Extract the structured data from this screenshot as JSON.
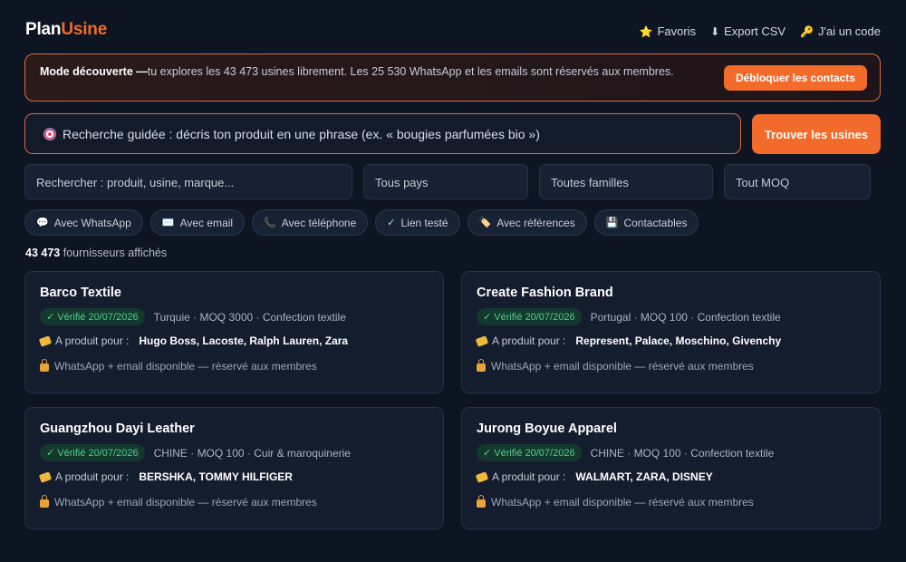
{
  "header": {
    "logo_part1": "Plan",
    "logo_part2": "Usine",
    "links": [
      {
        "icon": "star-icon",
        "glyph": "⭐",
        "label": "Favoris"
      },
      {
        "icon": "download-icon",
        "glyph": "⬇",
        "label": "Export CSV"
      },
      {
        "icon": "key-icon",
        "glyph": "🔑",
        "label": "J'ai un code"
      }
    ]
  },
  "banner": {
    "title": "Mode découverte —",
    "text": "tu explores les 43 473 usines librement. Les 25 530 WhatsApp et les emails sont réservés aux membres.",
    "button": "Débloquer les contacts"
  },
  "guided_search": {
    "placeholder": "Recherche guidée : décris ton produit en une phrase (ex. « bougies parfumées bio »)",
    "button": "Trouver les usines"
  },
  "filters": {
    "search": "Rechercher : produit, usine, marque...",
    "country": "Tous pays",
    "family": "Toutes familles",
    "moq": "Tout MOQ"
  },
  "chips": [
    {
      "icon": "chat-icon",
      "glyph": "💬",
      "label": "Avec WhatsApp"
    },
    {
      "icon": "mail-icon",
      "glyph": "✉️",
      "label": "Avec email"
    },
    {
      "icon": "phone-icon",
      "glyph": "📞",
      "label": "Avec téléphone"
    },
    {
      "icon": "check-icon",
      "glyph": "✓",
      "label": "Lien testé"
    },
    {
      "icon": "tag-icon",
      "glyph": "🏷️",
      "label": "Avec références"
    },
    {
      "icon": "save-icon",
      "glyph": "💾",
      "label": "Contactables"
    }
  ],
  "results": {
    "count": "43 473",
    "label": "fournisseurs affichés"
  },
  "cards": [
    {
      "name": "Barco Textile",
      "badge": "✓ Vérifié 20/07/2026",
      "meta": "Turquie · MOQ 3000 · Confection textile",
      "produced_label": "A produit pour :",
      "brands": "Hugo Boss, Lacoste, Ralph Lauren, Zara",
      "lock": "WhatsApp + email disponible — réservé aux membres"
    },
    {
      "name": "Create Fashion Brand",
      "badge": "✓ Vérifié 20/07/2026",
      "meta": "Portugal · MOQ 100 · Confection textile",
      "produced_label": "A produit pour :",
      "brands": "Represent, Palace, Moschino, Givenchy",
      "lock": "WhatsApp + email disponible — réservé aux membres"
    },
    {
      "name": "Guangzhou Dayi Leather",
      "badge": "✓ Vérifié 20/07/2026",
      "meta": "CHINE · MOQ 100 · Cuir & maroquinerie",
      "produced_label": "A produit pour :",
      "brands": "BERSHKA, TOMMY HILFIGER",
      "lock": "WhatsApp + email disponible — réservé aux membres"
    },
    {
      "name": "Jurong Boyue Apparel",
      "badge": "✓ Vérifié 20/07/2026",
      "meta": "CHINE · MOQ 100 · Confection textile",
      "produced_label": "A produit pour :",
      "brands": "WALMART, ZARA, DISNEY",
      "lock": "WhatsApp + email disponible — réservé aux membres"
    }
  ]
}
